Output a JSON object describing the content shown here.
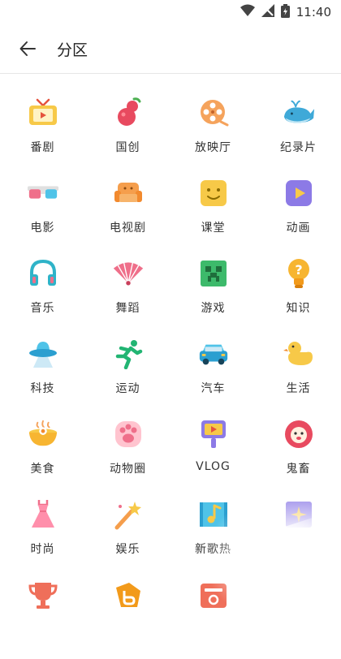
{
  "status": {
    "time": "11:40"
  },
  "header": {
    "title": "分区"
  },
  "categories": [
    {
      "label": "番剧",
      "icon": "tv-icon"
    },
    {
      "label": "国创",
      "icon": "gourd-icon"
    },
    {
      "label": "放映厅",
      "icon": "film-reel-icon"
    },
    {
      "label": "纪录片",
      "icon": "whale-icon"
    },
    {
      "label": "电影",
      "icon": "3d-glasses-icon"
    },
    {
      "label": "电视剧",
      "icon": "sofa-icon"
    },
    {
      "label": "课堂",
      "icon": "blackboard-icon"
    },
    {
      "label": "动画",
      "icon": "play-box-icon"
    },
    {
      "label": "音乐",
      "icon": "headphones-icon"
    },
    {
      "label": "舞蹈",
      "icon": "fan-icon"
    },
    {
      "label": "游戏",
      "icon": "game-face-icon"
    },
    {
      "label": "知识",
      "icon": "lightbulb-icon"
    },
    {
      "label": "科技",
      "icon": "ufo-icon"
    },
    {
      "label": "运动",
      "icon": "runner-icon"
    },
    {
      "label": "汽车",
      "icon": "car-icon"
    },
    {
      "label": "生活",
      "icon": "duck-icon"
    },
    {
      "label": "美食",
      "icon": "food-bowl-icon"
    },
    {
      "label": "动物圈",
      "icon": "paw-icon"
    },
    {
      "label": "VLOG",
      "icon": "vlog-camera-icon"
    },
    {
      "label": "鬼畜",
      "icon": "lion-face-icon"
    },
    {
      "label": "时尚",
      "icon": "dress-icon"
    },
    {
      "label": "娱乐",
      "icon": "magic-wand-icon"
    },
    {
      "label": "新歌热",
      "icon": "music-note-icon"
    },
    {
      "label": "",
      "icon": "sparkle-card-icon"
    },
    {
      "label": "",
      "icon": "trophy-icon"
    },
    {
      "label": "",
      "icon": "tag-icon"
    },
    {
      "label": "",
      "icon": "card-icon"
    },
    {
      "label": "",
      "icon": "blank"
    }
  ]
}
